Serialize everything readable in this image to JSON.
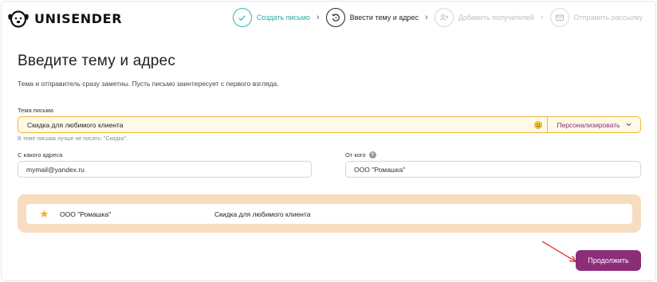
{
  "brand": {
    "name": "UNISENDER"
  },
  "steps": [
    {
      "label": "Создать письмо",
      "state": "done",
      "icon": "check-icon"
    },
    {
      "label": "Ввести тему и адрес",
      "state": "active",
      "icon": "back-arrow-icon"
    },
    {
      "label": "Добавить получателей",
      "state": "todo",
      "icon": "add-user-icon"
    },
    {
      "label": "Отправить рассылку",
      "state": "todo",
      "icon": "mail-icon"
    }
  ],
  "page": {
    "title": "Введите тему и адрес",
    "subtitle": "Тема и отправитель сразу заметны. Пусть письмо заинтересует с первого взгляда."
  },
  "subject": {
    "label": "Тема письма",
    "value": "Скидка для любимого клиента",
    "hint": "В теме письма лучше не писать: \"Скидка\".",
    "personalize_label": "Персонализировать"
  },
  "from_email": {
    "label": "С какого адреса",
    "value": "mymail@yandex.ru"
  },
  "from_name": {
    "label": "От кого",
    "value": "ООО \"Ромашка\""
  },
  "preview": {
    "from": "ООО \"Ромашка\"",
    "subject": "Скидка для любимого клиента"
  },
  "actions": {
    "continue_label": "Продолжить"
  },
  "colors": {
    "accent": "#8c2d7a",
    "done": "#2fb5b1",
    "warning_border": "#f2b63d",
    "preview_bg": "#f7dcbf"
  }
}
